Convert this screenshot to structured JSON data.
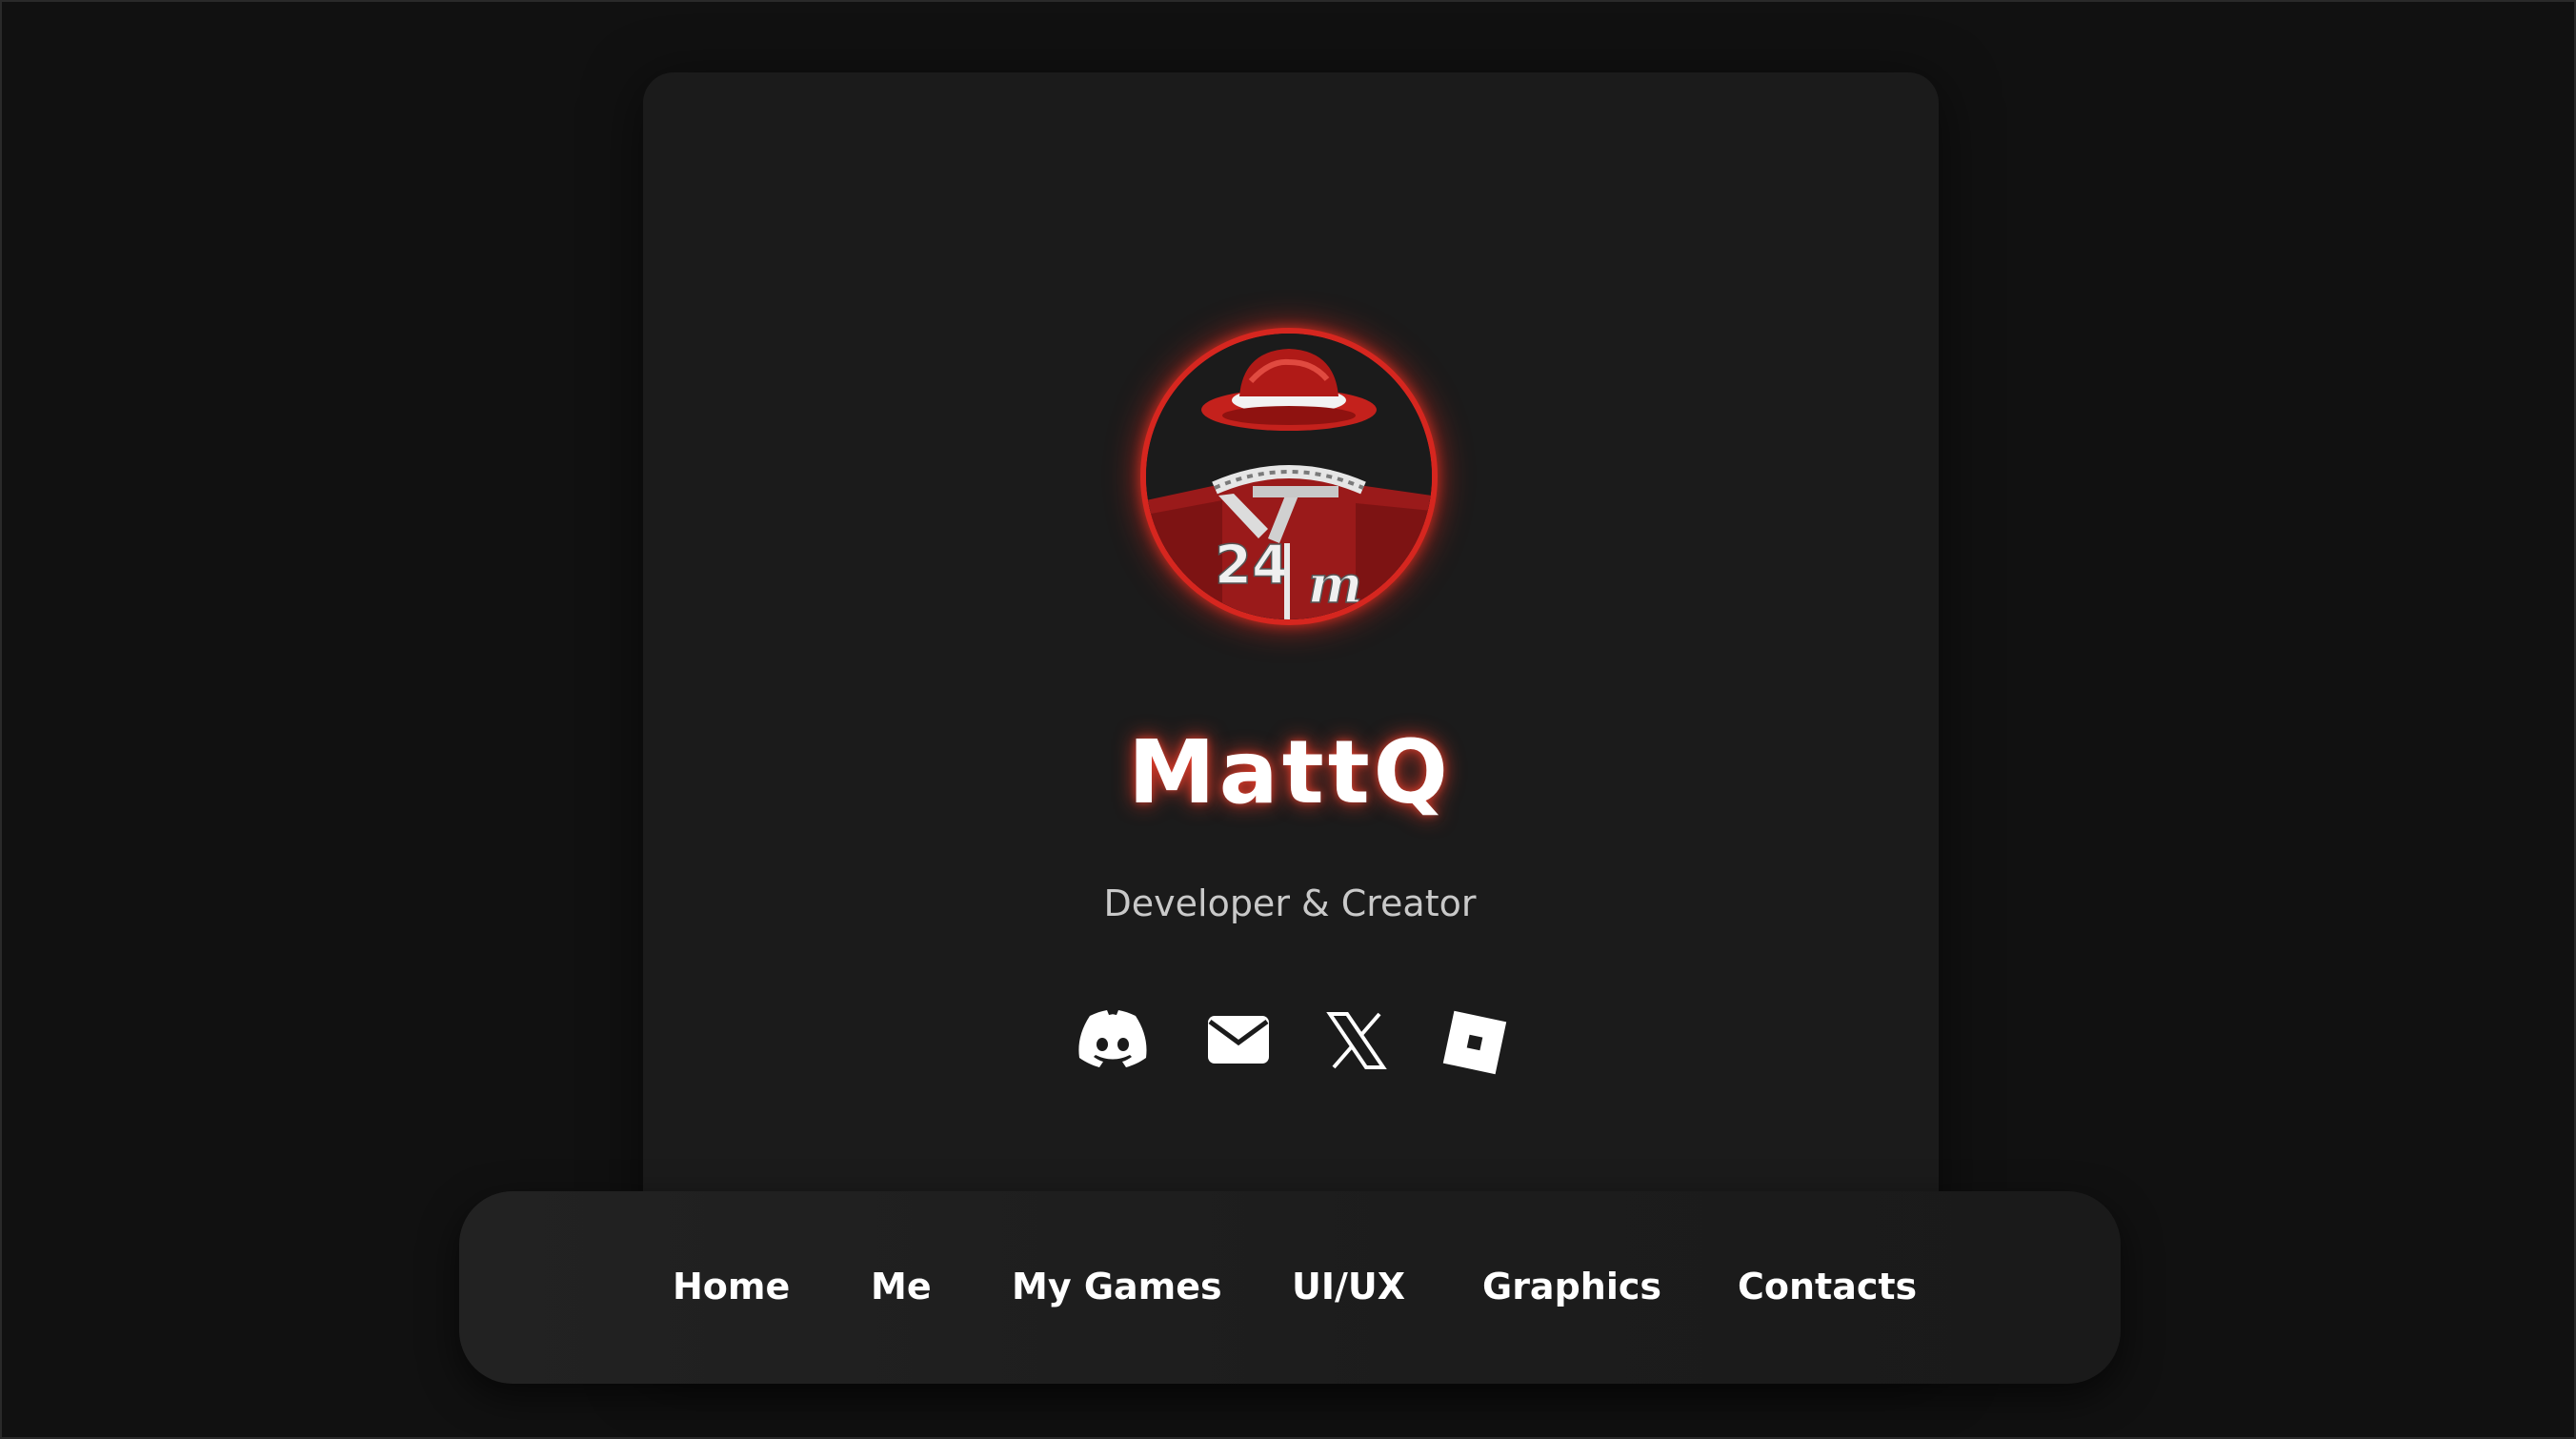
{
  "profile": {
    "name": "MattQ",
    "tagline": "Developer & Creator",
    "avatar_icon": "avatar-icon"
  },
  "socials": [
    {
      "name": "discord-icon"
    },
    {
      "name": "mail-icon"
    },
    {
      "name": "x-icon"
    },
    {
      "name": "roblox-icon"
    }
  ],
  "nav": {
    "items": [
      {
        "label": "Home"
      },
      {
        "label": "Me"
      },
      {
        "label": "My Games"
      },
      {
        "label": "UI/UX"
      },
      {
        "label": "Graphics"
      },
      {
        "label": "Contacts"
      }
    ]
  },
  "colors": {
    "background": "#111111",
    "card": "#1b1b1b",
    "accent": "#d6261f",
    "text": "#ffffff",
    "muted_text": "#c9c9c9"
  }
}
